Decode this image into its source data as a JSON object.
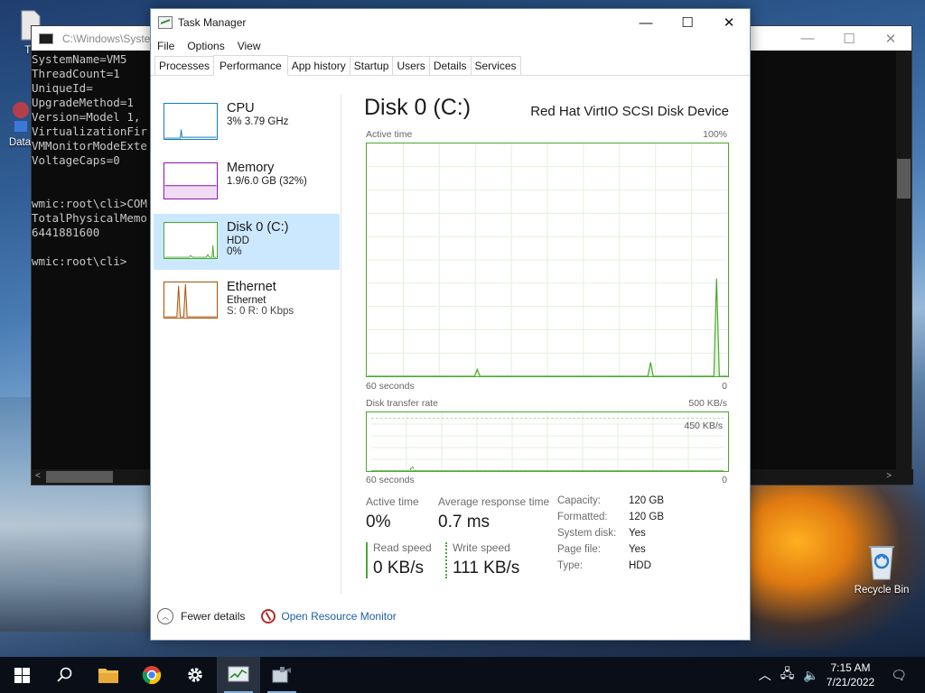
{
  "colors": {
    "disk_accent": "#4aa82e",
    "cpu_accent": "#117dbb",
    "memory_accent": "#8b12ae",
    "ethernet_accent": "#a74f01",
    "selected_bg": "#cce8ff"
  },
  "desktop": {
    "icons": [
      {
        "label": "Th",
        "icon": "document-icon"
      },
      {
        "label": "Data",
        "icon": "app-shortcut-icon"
      },
      {
        "label": "Recycle Bin",
        "icon": "recycle-bin-icon"
      }
    ]
  },
  "console": {
    "title": "C:\\Windows\\Syster",
    "lines": [
      "SystemName=VM5",
      "ThreadCount=1",
      "UniqueId=",
      "UpgradeMethod=1",
      "Version=Model 1,",
      "VirtualizationFir",
      "VMMonitorModeExte",
      "VoltageCaps=0",
      "",
      "",
      "wmic:root\\cli>COM",
      "TotalPhysicalMemo",
      "6441881600",
      "",
      "wmic:root\\cli>"
    ]
  },
  "task_manager": {
    "title": "Task Manager",
    "menu": [
      "File",
      "Options",
      "View"
    ],
    "tabs": [
      {
        "label": "Processes",
        "active": false
      },
      {
        "label": "Performance",
        "active": true
      },
      {
        "label": "App history",
        "active": false
      },
      {
        "label": "Startup",
        "active": false
      },
      {
        "label": "Users",
        "active": false
      },
      {
        "label": "Details",
        "active": false
      },
      {
        "label": "Services",
        "active": false
      }
    ],
    "sidebar": [
      {
        "name": "CPU",
        "sub": "3%  3.79 GHz",
        "sub2": ""
      },
      {
        "name": "Memory",
        "sub": "1.9/6.0 GB (32%)",
        "sub2": ""
      },
      {
        "name": "Disk 0 (C:)",
        "sub": "HDD",
        "sub2": "0%"
      },
      {
        "name": "Ethernet",
        "sub": "Ethernet",
        "sub2": "S: 0  R: 0 Kbps"
      }
    ],
    "disk": {
      "title": "Disk 0 (C:)",
      "model": "Red Hat VirtIO SCSI Disk Device",
      "active_graph": {
        "label": "Active time",
        "max_label": "100%",
        "x_left": "60 seconds",
        "x_right": "0",
        "values_pct": [
          0,
          0,
          0,
          0,
          0,
          0,
          0,
          0,
          0,
          0,
          0,
          0,
          0,
          0,
          0,
          0,
          0,
          0,
          0,
          0,
          0,
          0,
          0,
          0,
          0,
          0,
          0,
          0,
          0,
          0,
          0,
          0,
          0,
          0,
          0,
          0,
          0,
          0,
          0,
          0,
          3,
          0,
          0,
          0,
          0,
          0,
          0,
          0,
          0,
          0,
          0,
          0,
          0,
          0,
          0,
          0,
          0,
          0,
          0,
          0,
          0,
          0,
          0,
          0,
          0,
          0,
          0,
          0,
          0,
          0,
          0,
          0,
          0,
          0,
          0,
          0,
          0,
          0,
          0,
          0,
          0,
          0,
          0,
          0,
          0,
          0,
          0,
          0,
          0,
          0,
          0,
          0,
          0,
          0,
          0,
          0,
          0,
          0,
          0,
          0,
          0,
          0,
          0,
          6,
          0,
          0,
          0,
          0,
          0,
          0,
          0,
          0,
          0,
          0,
          0,
          0,
          0,
          0,
          0,
          0,
          0,
          0,
          0,
          0,
          0,
          0,
          0,
          42,
          0,
          0,
          0,
          0
        ]
      },
      "transfer_graph": {
        "label": "Disk transfer rate",
        "max_label": "500 KB/s",
        "ref_label": "450 KB/s",
        "x_left": "60 seconds",
        "x_right": "0",
        "values_kbs": [
          0,
          0,
          0,
          0,
          0,
          0,
          0,
          0,
          0,
          0,
          0,
          0,
          0,
          0,
          0,
          0,
          0,
          0,
          0,
          0,
          0,
          0,
          0,
          0,
          0,
          0,
          0,
          0,
          0,
          0,
          0,
          0,
          0,
          0,
          0,
          0,
          0,
          0,
          0,
          0,
          0,
          0,
          0,
          0,
          0,
          0,
          0,
          0,
          0,
          0,
          0,
          0,
          0,
          0,
          0,
          0,
          0,
          0,
          0,
          0,
          0,
          0,
          0,
          0,
          0,
          0,
          0,
          0,
          0,
          0,
          0,
          0,
          0,
          0,
          0,
          0,
          0,
          0,
          0,
          0,
          0,
          0,
          0,
          0,
          0,
          0,
          0,
          0,
          0,
          0,
          0,
          0,
          0,
          0,
          0,
          0,
          0,
          0,
          0,
          0,
          0,
          0,
          0,
          0,
          0,
          0,
          0,
          0,
          0,
          0,
          0,
          0,
          0,
          0,
          0,
          0,
          0,
          0,
          0,
          0,
          0,
          0,
          0,
          0,
          0,
          0,
          0,
          0,
          0,
          0
        ],
        "write_values_kbs": [
          0,
          0,
          0,
          0,
          0,
          0,
          0,
          0,
          0,
          0,
          0,
          0,
          0,
          0,
          0,
          40,
          0,
          0,
          0,
          0,
          0,
          0,
          0,
          0,
          0,
          0,
          0,
          0,
          0,
          0,
          0,
          0,
          0,
          0,
          0,
          0,
          0,
          0,
          0,
          0,
          0,
          0,
          0,
          0,
          0,
          0,
          0,
          0,
          0,
          0,
          0,
          0,
          0,
          0,
          0,
          0,
          0,
          0,
          0,
          0,
          0,
          0,
          0,
          0,
          0,
          0,
          0,
          0,
          0,
          0,
          0,
          0,
          0,
          0,
          0,
          0,
          0,
          0,
          0,
          0,
          0,
          0,
          0,
          0,
          0,
          0,
          0,
          0,
          0,
          0,
          0,
          0,
          0,
          0,
          0,
          0,
          0,
          0,
          0,
          0,
          0,
          0,
          0,
          0,
          0,
          0,
          0,
          0,
          0,
          0,
          0,
          0,
          0,
          0,
          0,
          0,
          0,
          0,
          0,
          0,
          0,
          0,
          0,
          0,
          0,
          0,
          0,
          0,
          0,
          0
        ]
      },
      "stats": {
        "active_time_label": "Active time",
        "active_time_value": "0%",
        "avg_response_label": "Average response time",
        "avg_response_value": "0.7 ms",
        "read_speed_label": "Read speed",
        "read_speed_value": "0 KB/s",
        "write_speed_label": "Write speed",
        "write_speed_value": "111 KB/s"
      },
      "properties": [
        {
          "label": "Capacity:",
          "value": "120 GB"
        },
        {
          "label": "Formatted:",
          "value": "120 GB"
        },
        {
          "label": "System disk:",
          "value": "Yes"
        },
        {
          "label": "Page file:",
          "value": "Yes"
        },
        {
          "label": "Type:",
          "value": "HDD"
        }
      ]
    },
    "footer": {
      "fewer_details": "Fewer details",
      "resource_monitor": "Open Resource Monitor"
    }
  },
  "taskbar": {
    "apps": [
      {
        "name": "start-button",
        "icon": "windows-logo-icon"
      },
      {
        "name": "search-button",
        "icon": "search-icon"
      },
      {
        "name": "file-explorer",
        "icon": "folder-icon"
      },
      {
        "name": "chrome",
        "icon": "chrome-icon"
      },
      {
        "name": "settings",
        "icon": "gear-icon"
      },
      {
        "name": "task-manager",
        "icon": "task-manager-icon"
      },
      {
        "name": "command-prompt",
        "icon": "console-tool-icon"
      }
    ],
    "time": "7:15 AM",
    "date": "7/21/2022"
  }
}
